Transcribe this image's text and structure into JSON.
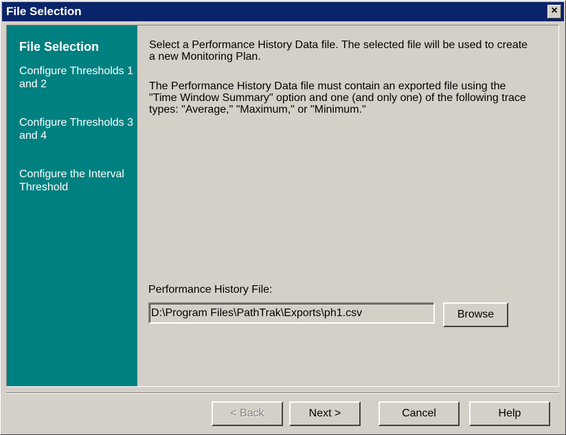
{
  "window": {
    "title": "File Selection",
    "close_label": "×"
  },
  "sidebar": {
    "title": "File Selection",
    "items": [
      {
        "label": "Configure Thresholds 1 and 2"
      },
      {
        "label": "Configure Thresholds 3 and 4"
      },
      {
        "label": "Configure the Interval Threshold"
      }
    ]
  },
  "main": {
    "intro": "Select a Performance History Data file.  The selected file will be used to create a new Monitoring Plan.",
    "description": "The Performance History Data file must contain an exported file using the \"Time Window Summary\" option and one (and only one) of the following trace types: \"Average,\" \"Maximum,\" or \"Minimum.\"",
    "file_label": "Performance History File:",
    "file_value": "D:\\Program Files\\PathTrak\\Exports\\ph1.csv",
    "browse_label": "Browse"
  },
  "buttons": {
    "back": "< Back",
    "next": "Next >",
    "cancel": "Cancel",
    "help": "Help"
  }
}
